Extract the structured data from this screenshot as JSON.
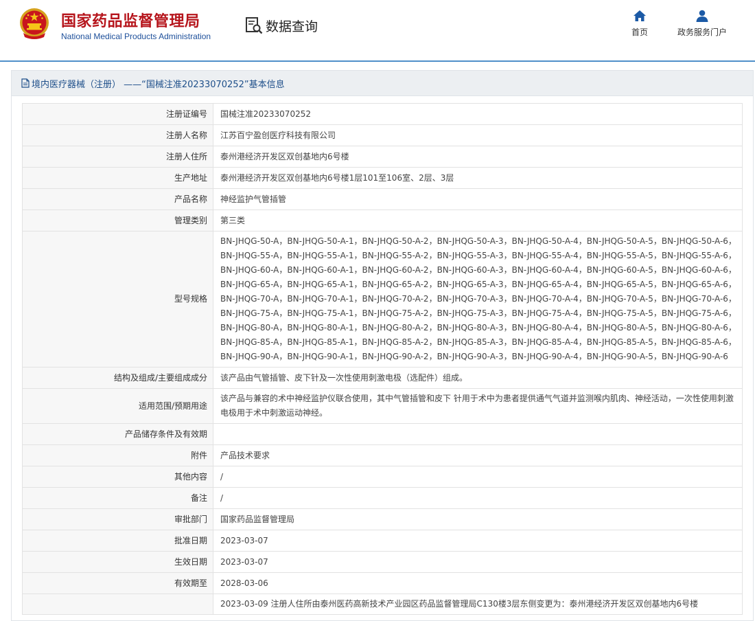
{
  "header": {
    "brand_cn": "国家药品监督管理局",
    "brand_en": "National Medical Products Administration",
    "query_label": "数据查询",
    "nav": [
      {
        "label": "首页",
        "icon": "home-icon"
      },
      {
        "label": "政务服务门户",
        "icon": "user-icon"
      }
    ]
  },
  "panel": {
    "title": "境内医疗器械（注册） ——“国械注准20233070252”基本信息",
    "title_icon": "document-icon"
  },
  "colors": {
    "brand_red": "#b6151c",
    "brand_blue": "#1d4f9a",
    "header_line": "#4f8fc9",
    "title_text": "#1e4f8a"
  },
  "rows": [
    {
      "label": "注册证编号",
      "value": "国械注准20233070252"
    },
    {
      "label": "注册人名称",
      "value": "江苏百宁盈创医疗科技有限公司"
    },
    {
      "label": "注册人住所",
      "value": "泰州港经济开发区双创基地内6号楼"
    },
    {
      "label": "生产地址",
      "value": "泰州港经济开发区双创基地内6号楼1层101至106室、2层、3层"
    },
    {
      "label": "产品名称",
      "value": "神经监护气管插管"
    },
    {
      "label": "管理类别",
      "value": "第三类"
    },
    {
      "label": "型号规格",
      "value": "BN-JHQG-50-A，BN-JHQG-50-A-1，BN-JHQG-50-A-2，BN-JHQG-50-A-3，BN-JHQG-50-A-4，BN-JHQG-50-A-5，BN-JHQG-50-A-6，BN-JHQG-55-A，BN-JHQG-55-A-1，BN-JHQG-55-A-2，BN-JHQG-55-A-3，BN-JHQG-55-A-4，BN-JHQG-55-A-5，BN-JHQG-55-A-6，BN-JHQG-60-A，BN-JHQG-60-A-1，BN-JHQG-60-A-2，BN-JHQG-60-A-3，BN-JHQG-60-A-4，BN-JHQG-60-A-5，BN-JHQG-60-A-6，BN-JHQG-65-A，BN-JHQG-65-A-1，BN-JHQG-65-A-2，BN-JHQG-65-A-3，BN-JHQG-65-A-4，BN-JHQG-65-A-5，BN-JHQG-65-A-6，BN-JHQG-70-A，BN-JHQG-70-A-1，BN-JHQG-70-A-2，BN-JHQG-70-A-3，BN-JHQG-70-A-4，BN-JHQG-70-A-5，BN-JHQG-70-A-6，BN-JHQG-75-A，BN-JHQG-75-A-1，BN-JHQG-75-A-2，BN-JHQG-75-A-3，BN-JHQG-75-A-4，BN-JHQG-75-A-5，BN-JHQG-75-A-6，BN-JHQG-80-A，BN-JHQG-80-A-1，BN-JHQG-80-A-2，BN-JHQG-80-A-3，BN-JHQG-80-A-4，BN-JHQG-80-A-5，BN-JHQG-80-A-6，BN-JHQG-85-A，BN-JHQG-85-A-1，BN-JHQG-85-A-2，BN-JHQG-85-A-3，BN-JHQG-85-A-4，BN-JHQG-85-A-5，BN-JHQG-85-A-6，BN-JHQG-90-A，BN-JHQG-90-A-1，BN-JHQG-90-A-2，BN-JHQG-90-A-3，BN-JHQG-90-A-4，BN-JHQG-90-A-5，BN-JHQG-90-A-6"
    },
    {
      "label": "结构及组成/主要组成成分",
      "value": "该产品由气管插管、皮下针及一次性使用刺激电极（选配件）组成。"
    },
    {
      "label": "适用范围/预期用途",
      "value": "该产品与兼容的术中神经监护仪联合使用，其中气管插管和皮下 针用于术中为患者提供通气气道并监测喉内肌肉、神经活动，一次性使用刺激电极用于术中刺激运动神经。"
    },
    {
      "label": "产品储存条件及有效期",
      "value": ""
    },
    {
      "label": "附件",
      "value": "产品技术要求"
    },
    {
      "label": "其他内容",
      "value": "/"
    },
    {
      "label": "备注",
      "value": "/"
    },
    {
      "label": "审批部门",
      "value": "国家药品监督管理局"
    },
    {
      "label": "批准日期",
      "value": "2023-03-07"
    },
    {
      "label": "生效日期",
      "value": "2023-03-07"
    },
    {
      "label": "有效期至",
      "value": "2028-03-06"
    },
    {
      "label": "",
      "value": "2023-03-09 注册人住所由泰州医药高新技术产业园区药品监督管理局C130楼3层东侧变更为：泰州港经济开发区双创基地内6号楼"
    }
  ]
}
